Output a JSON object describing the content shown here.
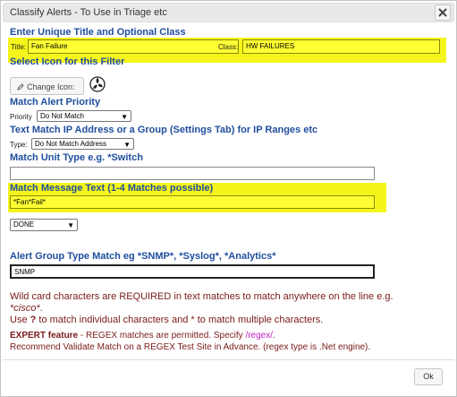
{
  "window": {
    "title": "Classify Alerts - To Use in Triage etc"
  },
  "section_title_class": {
    "heading": "Enter Unique Title and Optional Class",
    "title_label": "Title:",
    "title_value": "Fan Failure",
    "class_label": "Class:",
    "class_value": "HW FAILURES"
  },
  "section_icon": {
    "heading": "Select Icon for this Filter",
    "change_icon_label": "Change Icon:"
  },
  "section_priority": {
    "heading": "Match Alert Priority",
    "label": "Priority",
    "selected": "Do Not Match"
  },
  "section_ip": {
    "heading": "Text Match IP Address or a Group (Settings Tab) for IP Ranges etc",
    "label": "Type:",
    "selected": "Do Not Match Address"
  },
  "section_unit": {
    "heading": "Match Unit Type e.g. *Switch",
    "value": ""
  },
  "section_message": {
    "heading": "Match Message Text (1-4 Matches possible)",
    "value": "*Fan*Fail*",
    "done_selected": "DONE"
  },
  "section_group": {
    "heading": "Alert Group Type Match eg *SNMP*, *Syslog*, *Analytics*",
    "value": "SNMP"
  },
  "notes": {
    "line1": "Wild card characters are REQUIRED in text matches to match anywhere on the line e.g.",
    "line1_example": "*cisco*",
    "line1_end": ".",
    "line2_a": "Use ",
    "line2_q": "?",
    "line2_b": " to match individual characters and * to match multiple characters.",
    "expert_label": "EXPERT feature",
    "expert_text": " - REGEX matches are permitted. Specify ",
    "expert_regex": "/regex/",
    "expert_end": ".",
    "recommend": "Recommend Validate Match on a REGEX Test Site in Advance. (regex type is .Net engine)."
  },
  "footer": {
    "ok_label": "Ok"
  },
  "colors": {
    "heading": "#1f4e9e",
    "highlight": "#f5f51b",
    "note_text": "#7a1a1a",
    "regex": "#c41fc4"
  },
  "icons": {
    "close": "close-icon",
    "pencil": "pencil-icon",
    "fan": "fan-icon"
  }
}
